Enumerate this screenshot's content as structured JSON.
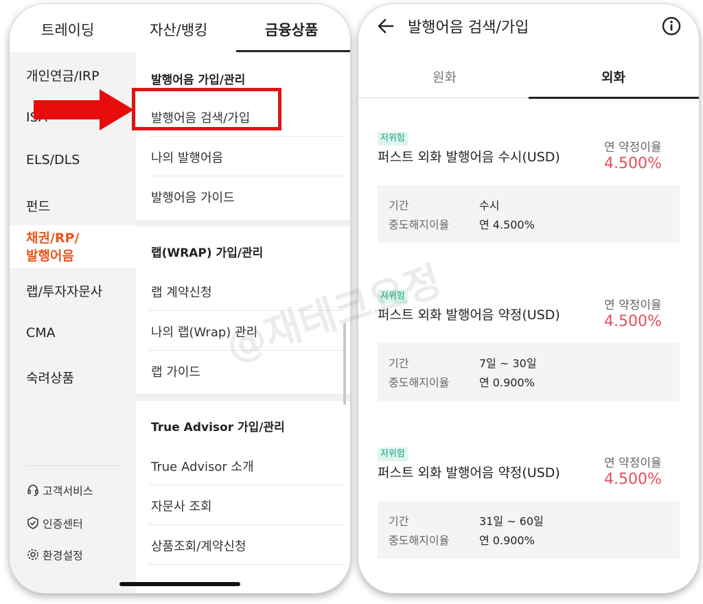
{
  "left_screen": {
    "top_tabs": [
      "트레이딩",
      "자산/뱅킹",
      "금융상품"
    ],
    "active_top_tab": "금융상품",
    "sidebar": {
      "items": [
        "개인연금/IRP",
        "ISA",
        "ELS/DLS",
        "펀드",
        "채권/RP/\n발행어음",
        "랩/투자자문사",
        "CMA",
        "숙려상품"
      ],
      "active_item_line1": "채권/RP/",
      "active_item_line2": "발행어음",
      "footer": [
        "고객서비스",
        "인증센터",
        "환경설정"
      ]
    },
    "menu": {
      "section1_title": "발행어음 가입/관리",
      "section1_items": [
        "발행어음 검색/가입",
        "나의 발행어음",
        "발행어음 가이드"
      ],
      "section2_title": "랩(WRAP) 가입/관리",
      "section2_items": [
        "랩 계약신청",
        "나의 랩(Wrap) 관리",
        "랩 가이드"
      ],
      "section3_title": "True Advisor 가입/관리",
      "section3_items": [
        "True Advisor 소개",
        "자문사 조회",
        "상품조회/계약신청"
      ]
    },
    "highlight_color": "#e01414"
  },
  "right_screen": {
    "title": "발행어음 검색/가입",
    "tabs": [
      "원화",
      "외화"
    ],
    "active_tab": "외화",
    "products": [
      {
        "badge": "저위험",
        "name": "퍼스트 외화 발행어음 수시(USD)",
        "rate_label": "연 약정이율",
        "rate": "4.500%",
        "period_label": "기간",
        "period": "수시",
        "early_label": "중도해지이율",
        "early_rate": "연 4.500%"
      },
      {
        "badge": "저위험",
        "name": "퍼스트 외화 발행어음 약정(USD)",
        "rate_label": "연 약정이율",
        "rate": "4.500%",
        "period_label": "기간",
        "period": "7일 ~ 30일",
        "early_label": "중도해지이율",
        "early_rate": "연 0.900%"
      },
      {
        "badge": "저위험",
        "name": "퍼스트 외화 발행어음 약정(USD)",
        "rate_label": "연 약정이율",
        "rate": "4.500%",
        "period_label": "기간",
        "period": "31일 ~ 60일",
        "early_label": "중도해지이율",
        "early_rate": "연 0.900%"
      }
    ],
    "rate_color": "#e0505a",
    "badge_color": "#1aa37a"
  },
  "watermark": "@재테크요정"
}
